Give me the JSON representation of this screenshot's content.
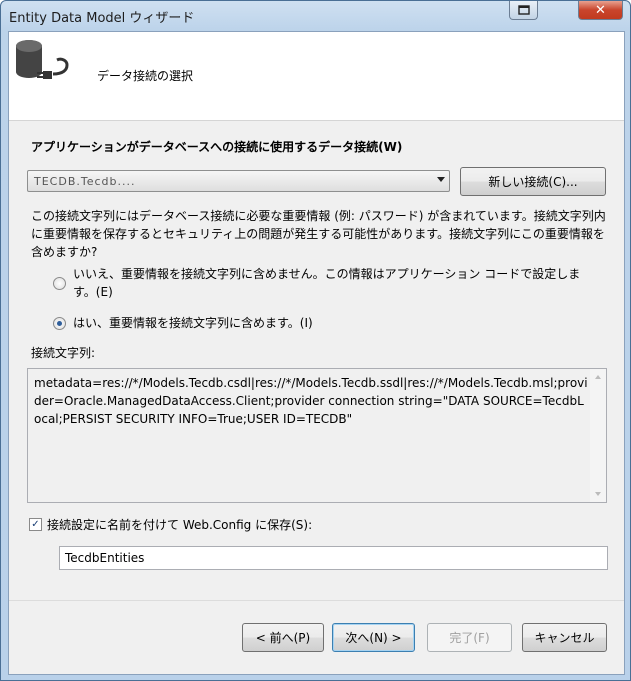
{
  "window": {
    "title": "Entity Data Model ウィザード"
  },
  "header": {
    "title": "データ接続の選択",
    "icon": "database-plug-icon"
  },
  "connection": {
    "label": "アプリケーションがデータベースへの接続に使用するデータ接続(W)",
    "selected_value": "TECDB.Tecdb....",
    "new_connection_button": "新しい接続(C)..."
  },
  "sensitive_info": {
    "description": "この接続文字列にはデータベース接続に必要な重要情報 (例: パスワード) が含まれています。接続文字列内に重要情報を保存するとセキュリティ上の問題が発生する可能性があります。接続文字列にこの重要情報を含めますか?",
    "option_exclude": "いいえ、重要情報を接続文字列に含めません。この情報はアプリケーション コードで設定します。(E)",
    "option_include": "はい、重要情報を接続文字列に含めます。(I)",
    "selected": "include"
  },
  "connection_string": {
    "label": "接続文字列:",
    "value": "metadata=res://*/Models.Tecdb.csdl|res://*/Models.Tecdb.ssdl|res://*/Models.Tecdb.msl;provider=Oracle.ManagedDataAccess.Client;provider connection string=\"DATA SOURCE=TecdbLocal;PERSIST SECURITY INFO=True;USER ID=TECDB\""
  },
  "save_config": {
    "checked": true,
    "label": "接続設定に名前を付けて Web.Config に保存(S):",
    "name_value": "TecdbEntities"
  },
  "footer": {
    "back": "< 前へ(P)",
    "next": "次へ(N) >",
    "finish": "完了(F)",
    "cancel": "キャンセル"
  }
}
